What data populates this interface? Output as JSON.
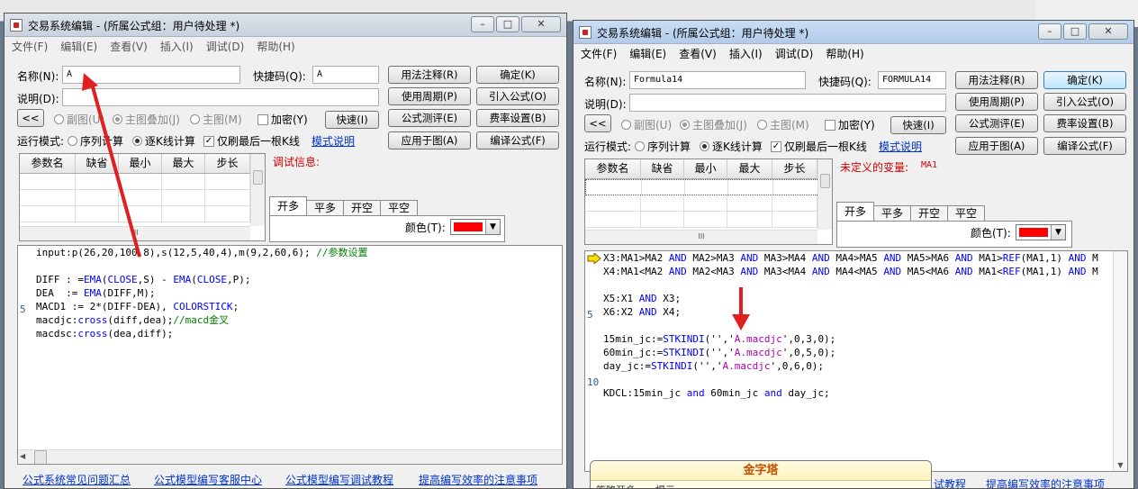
{
  "left_window": {
    "title": "交易系统编辑 - (所属公式组：用户待处理 *)",
    "menu": [
      "文件(F)",
      "编辑(E)",
      "查看(V)",
      "插入(I)",
      "调试(D)",
      "帮助(H)"
    ],
    "name_label": "名称(N):",
    "name_value": "A",
    "shortcut_label": "快捷码(Q):",
    "shortcut_value": "A",
    "desc_label": "说明(D):",
    "desc_value": "",
    "buttons": {
      "usage": "用法注释(R)",
      "ok": "确定(K)",
      "period": "使用周期(P)",
      "import": "引入公式(O)",
      "test": "公式测评(E)",
      "fee": "费率设置(B)",
      "apply": "应用于图(A)",
      "compile": "编译公式(F)",
      "quick": "快速(I)",
      "collapse": "<<"
    },
    "radios": {
      "sub": "副图(U)",
      "main_overlay": "主图叠加(J)",
      "main": "主图(M)"
    },
    "encrypt": "加密(Y)",
    "run_mode_label": "运行模式:",
    "run_seq": "序列计算",
    "run_kline": "逐K线计算",
    "refresh_last": "仅刷最后一根K线",
    "mode_link": "模式说明",
    "grid_headers": [
      "参数名",
      "缺省",
      "最小",
      "最大",
      "步长"
    ],
    "debug_label": "调试信息:",
    "tabs": [
      "开多",
      "平多",
      "开空",
      "平空"
    ],
    "color_label": "颜色(T):",
    "color_value": "#ff0000",
    "code_lines": [
      {
        "segs": [
          {
            "t": "input:p(26,20,100,8),s(12,5,40,4),m(9,2,60,6); "
          },
          {
            "t": "//参数设置",
            "c": "cm"
          }
        ]
      },
      {
        "segs": [
          {
            "t": ""
          }
        ]
      },
      {
        "segs": [
          {
            "t": "DIFF : ="
          },
          {
            "t": "EMA",
            "c": "f"
          },
          {
            "t": "("
          },
          {
            "t": "CLOSE",
            "c": "k"
          },
          {
            "t": ",S) - "
          },
          {
            "t": "EMA",
            "c": "f"
          },
          {
            "t": "("
          },
          {
            "t": "CLOSE",
            "c": "k"
          },
          {
            "t": ",P);"
          }
        ]
      },
      {
        "segs": [
          {
            "t": "DEA  := "
          },
          {
            "t": "EMA",
            "c": "f"
          },
          {
            "t": "(DIFF,M);"
          }
        ]
      },
      {
        "segs": [
          {
            "t": "MACD1 := 2*(DIFF-DEA), "
          },
          {
            "t": "COLORSTICK",
            "c": "k"
          },
          {
            "t": ";"
          }
        ]
      },
      {
        "segs": [
          {
            "t": "macdjc:"
          },
          {
            "t": "cross",
            "c": "f"
          },
          {
            "t": "(diff,dea);"
          },
          {
            "t": "//macd金叉",
            "c": "cm"
          }
        ]
      },
      {
        "segs": [
          {
            "t": "macdsc:"
          },
          {
            "t": "cross",
            "c": "f"
          },
          {
            "t": "(dea,diff);"
          }
        ]
      }
    ],
    "line_number": "5",
    "footer_links": [
      "公式系统常见问题汇总",
      "公式模型编写客服中心",
      "公式模型编写调试教程",
      "提高编写效率的注意事项"
    ]
  },
  "right_window": {
    "title": "交易系统编辑 - (所属公式组：用户待处理 *)",
    "menu": [
      "文件(F)",
      "编辑(E)",
      "查看(V)",
      "插入(I)",
      "调试(D)",
      "帮助(H)"
    ],
    "name_label": "名称(N):",
    "name_value": "Formula14",
    "shortcut_label": "快捷码(Q):",
    "shortcut_value": "FORMULA14",
    "desc_label": "说明(D):",
    "desc_value": "",
    "buttons": {
      "usage": "用法注释(R)",
      "ok": "确定(K)",
      "period": "使用周期(P)",
      "import": "引入公式(O)",
      "test": "公式测评(E)",
      "fee": "费率设置(B)",
      "apply": "应用于图(A)",
      "compile": "编译公式(F)",
      "quick": "快速(I)",
      "collapse": "<<"
    },
    "radios": {
      "sub": "副图(U)",
      "main_overlay": "主图叠加(J)",
      "main": "主图(M)"
    },
    "encrypt": "加密(Y)",
    "run_mode_label": "运行模式:",
    "run_seq": "序列计算",
    "run_kline": "逐K线计算",
    "refresh_last": "仅刷最后一根K线",
    "mode_link": "模式说明",
    "grid_headers": [
      "参数名",
      "缺省",
      "最小",
      "最大",
      "步长"
    ],
    "debug_label": "未定义的变量:",
    "debug_value": "MA1",
    "tabs": [
      "开多",
      "平多",
      "开空",
      "平空"
    ],
    "color_label": "颜色(T):",
    "color_value": "#ff0000",
    "code_lines": [
      {
        "segs": [
          {
            "t": "X3:MA1>MA2 "
          },
          {
            "t": "AND",
            "c": "k"
          },
          {
            "t": " MA2>MA3 "
          },
          {
            "t": "AND",
            "c": "k"
          },
          {
            "t": " MA3>MA4 "
          },
          {
            "t": "AND",
            "c": "k"
          },
          {
            "t": " MA4>MA5 "
          },
          {
            "t": "AND",
            "c": "k"
          },
          {
            "t": " MA5>MA6 "
          },
          {
            "t": "AND",
            "c": "k"
          },
          {
            "t": " MA1>"
          },
          {
            "t": "REF",
            "c": "f"
          },
          {
            "t": "(MA1,1) "
          },
          {
            "t": "AND",
            "c": "k"
          },
          {
            "t": " M"
          }
        ]
      },
      {
        "segs": [
          {
            "t": "X4:MA1<MA2 "
          },
          {
            "t": "AND",
            "c": "k"
          },
          {
            "t": " MA2<MA3 "
          },
          {
            "t": "AND",
            "c": "k"
          },
          {
            "t": " MA3<MA4 "
          },
          {
            "t": "AND",
            "c": "k"
          },
          {
            "t": " MA4<MA5 "
          },
          {
            "t": "AND",
            "c": "k"
          },
          {
            "t": " MA5<MA6 "
          },
          {
            "t": "AND",
            "c": "k"
          },
          {
            "t": " MA1<"
          },
          {
            "t": "REF",
            "c": "f"
          },
          {
            "t": "(MA1,1) "
          },
          {
            "t": "AND",
            "c": "k"
          },
          {
            "t": " M"
          }
        ]
      },
      {
        "segs": [
          {
            "t": ""
          }
        ]
      },
      {
        "segs": [
          {
            "t": "X5:X1 "
          },
          {
            "t": "AND",
            "c": "k"
          },
          {
            "t": " X3;"
          }
        ]
      },
      {
        "segs": [
          {
            "t": "X6:X2 "
          },
          {
            "t": "AND",
            "c": "k"
          },
          {
            "t": " X4;"
          }
        ]
      },
      {
        "segs": [
          {
            "t": ""
          }
        ]
      },
      {
        "segs": [
          {
            "t": "15min_jc:="
          },
          {
            "t": "STKINDI",
            "c": "f"
          },
          {
            "t": "('','"
          },
          {
            "t": "A.macdjc",
            "c": "m"
          },
          {
            "t": "',0,3,0);"
          }
        ]
      },
      {
        "segs": [
          {
            "t": "60min_jc:="
          },
          {
            "t": "STKINDI",
            "c": "f"
          },
          {
            "t": "('','"
          },
          {
            "t": "A.macdjc",
            "c": "m"
          },
          {
            "t": "',0,5,0);"
          }
        ]
      },
      {
        "segs": [
          {
            "t": "day_jc:="
          },
          {
            "t": "STKINDI",
            "c": "f"
          },
          {
            "t": "('','"
          },
          {
            "t": "A.macdjc",
            "c": "m"
          },
          {
            "t": "',0,6,0);"
          }
        ]
      },
      {
        "segs": [
          {
            "t": ""
          }
        ]
      },
      {
        "segs": [
          {
            "t": "KDCL:15min_jc "
          },
          {
            "t": "and",
            "c": "k"
          },
          {
            "t": " 60min_jc "
          },
          {
            "t": "and",
            "c": "k"
          },
          {
            "t": " day_jc;"
          }
        ]
      }
    ],
    "line_number_5": "5",
    "line_number_10": "10",
    "footer_links": [
      "试教程",
      "提高编写效率的注意事项"
    ],
    "popup_title": "金字塔",
    "popup_body": "策略开多……提示……"
  }
}
